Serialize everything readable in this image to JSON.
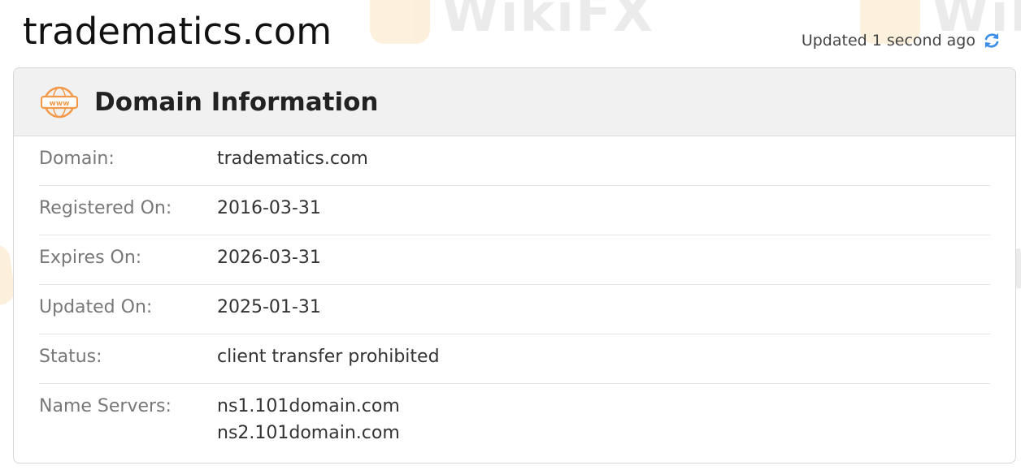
{
  "page": {
    "title": "tradematics.com",
    "updated_text": "Updated 1 second ago",
    "refresh_icon": "refresh-icon"
  },
  "watermark": {
    "text": "WikiFX"
  },
  "card": {
    "title": "Domain Information",
    "header_icon": "www-icon",
    "rows": [
      {
        "label": "Domain:",
        "values": [
          "tradematics.com"
        ]
      },
      {
        "label": "Registered On:",
        "values": [
          "2016-03-31"
        ]
      },
      {
        "label": "Expires On:",
        "values": [
          "2026-03-31"
        ]
      },
      {
        "label": "Updated On:",
        "values": [
          "2025-01-31"
        ]
      },
      {
        "label": "Status:",
        "values": [
          "client transfer prohibited"
        ]
      },
      {
        "label": "Name Servers:",
        "values": [
          "ns1.101domain.com",
          "ns2.101domain.com"
        ]
      }
    ]
  },
  "colors": {
    "accent_orange": "#f29a4a",
    "refresh_blue": "#3b8ee8"
  }
}
